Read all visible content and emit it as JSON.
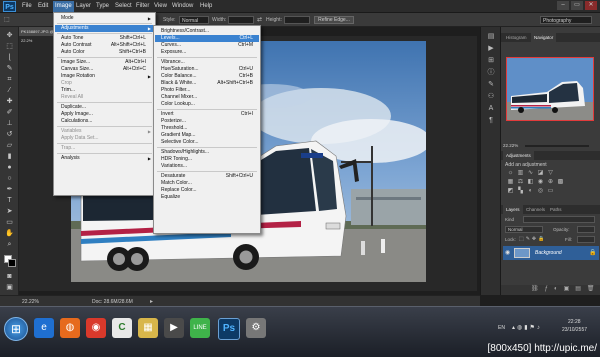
{
  "app": {
    "logo": "Ps"
  },
  "menubar": {
    "items": [
      "File",
      "Edit",
      "Image",
      "Layer",
      "Type",
      "Select",
      "Filter",
      "View",
      "Window",
      "Help"
    ],
    "active": "Image"
  },
  "window_controls": [
    "–",
    "▭",
    "✕"
  ],
  "options_bar": {
    "style_label": "Style:",
    "style_value": "Normal",
    "width_label": "Width:",
    "height_label": "Height:",
    "refine_edge": "Refine Edge...",
    "workspace": "Photography"
  },
  "document": {
    "tab": "PK158897.JPG @ 22.2%",
    "zoom": "22.22%",
    "doc_size": "Doc: 28.6M/28.6M"
  },
  "image_menu": {
    "groups": [
      [
        {
          "label": "Mode",
          "arrow": true
        }
      ],
      [
        {
          "label": "Adjustments",
          "arrow": true,
          "highlight": true
        }
      ],
      [
        {
          "label": "Auto Tone",
          "shortcut": "Shift+Ctrl+L"
        },
        {
          "label": "Auto Contrast",
          "shortcut": "Alt+Shift+Ctrl+L"
        },
        {
          "label": "Auto Color",
          "shortcut": "Shift+Ctrl+B"
        }
      ],
      [
        {
          "label": "Image Size...",
          "shortcut": "Alt+Ctrl+I"
        },
        {
          "label": "Canvas Size...",
          "shortcut": "Alt+Ctrl+C"
        },
        {
          "label": "Image Rotation",
          "arrow": true
        },
        {
          "label": "Crop",
          "disabled": true
        },
        {
          "label": "Trim..."
        },
        {
          "label": "Reveal All",
          "disabled": true
        }
      ],
      [
        {
          "label": "Duplicate..."
        },
        {
          "label": "Apply Image..."
        },
        {
          "label": "Calculations..."
        }
      ],
      [
        {
          "label": "Variables",
          "arrow": true,
          "disabled": true
        },
        {
          "label": "Apply Data Set...",
          "disabled": true
        }
      ],
      [
        {
          "label": "Trap...",
          "disabled": true
        }
      ],
      [
        {
          "label": "Analysis",
          "arrow": true
        }
      ]
    ]
  },
  "adjustments_menu": {
    "groups": [
      [
        {
          "label": "Brightness/Contrast..."
        },
        {
          "label": "Levels...",
          "shortcut": "Ctrl+L",
          "highlight": true
        },
        {
          "label": "Curves...",
          "shortcut": "Ctrl+M"
        },
        {
          "label": "Exposure..."
        }
      ],
      [
        {
          "label": "Vibrance..."
        },
        {
          "label": "Hue/Saturation...",
          "shortcut": "Ctrl+U"
        },
        {
          "label": "Color Balance...",
          "shortcut": "Ctrl+B"
        },
        {
          "label": "Black & White...",
          "shortcut": "Alt+Shift+Ctrl+B"
        },
        {
          "label": "Photo Filter..."
        },
        {
          "label": "Channel Mixer..."
        },
        {
          "label": "Color Lookup..."
        }
      ],
      [
        {
          "label": "Invert",
          "shortcut": "Ctrl+I"
        },
        {
          "label": "Posterize..."
        },
        {
          "label": "Threshold..."
        },
        {
          "label": "Gradient Map..."
        },
        {
          "label": "Selective Color..."
        }
      ],
      [
        {
          "label": "Shadows/Highlights..."
        },
        {
          "label": "HDR Toning..."
        },
        {
          "label": "Variations..."
        }
      ],
      [
        {
          "label": "Desaturate",
          "shortcut": "Shift+Ctrl+U"
        },
        {
          "label": "Match Color..."
        },
        {
          "label": "Replace Color..."
        },
        {
          "label": "Equalize"
        }
      ]
    ]
  },
  "panels": {
    "navigator_tabs": [
      "Histogram",
      "Navigator"
    ],
    "nav_zoom": "22.22%",
    "adjustments_title": "Adjustments",
    "add_adjustment": "Add an adjustment",
    "layers_tabs": [
      "Layers",
      "Channels",
      "Paths"
    ],
    "kind_label": "Kind",
    "blend_mode": "Normal",
    "opacity_label": "Opacity:",
    "lock_label": "Lock:",
    "fill_label": "Fill:",
    "layer_name": "Background"
  },
  "taskbar": {
    "language": "EN",
    "time": "22:28",
    "date": "23/10/2557"
  },
  "watermark": "[800x450] http://upic.me/"
}
